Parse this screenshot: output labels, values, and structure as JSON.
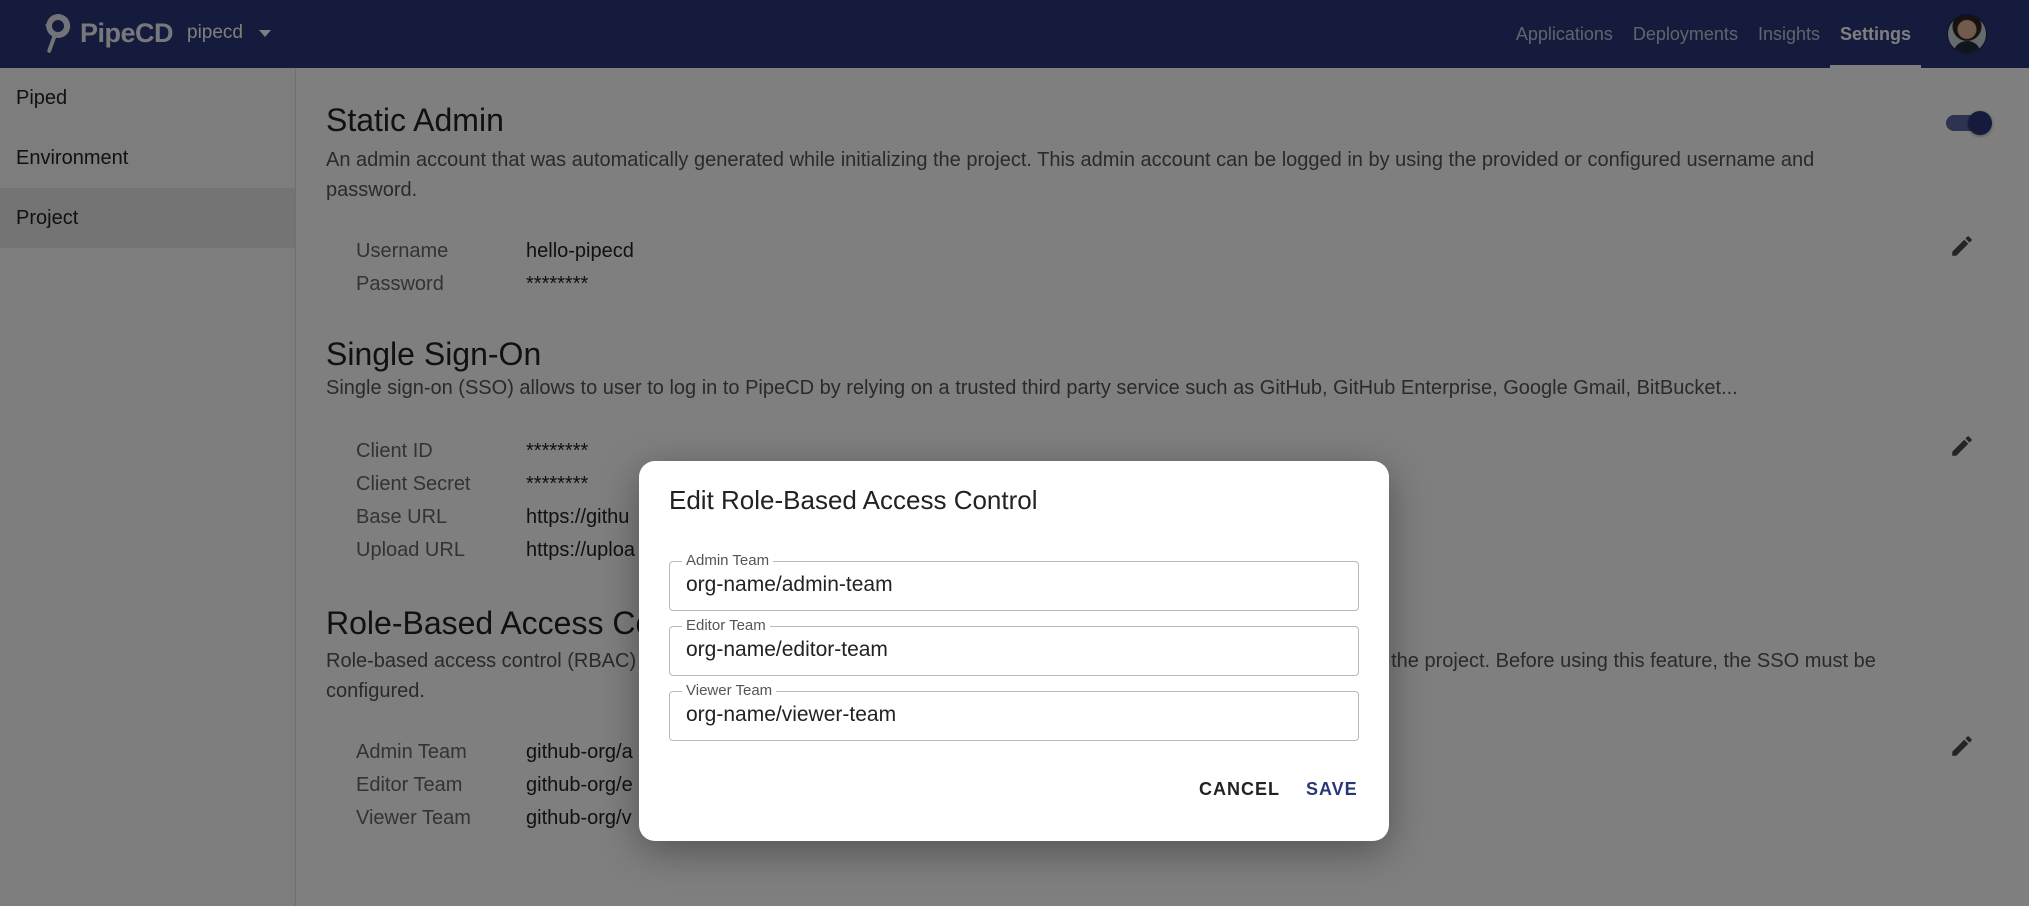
{
  "header": {
    "logo_text": "PipeCD",
    "project": "pipecd",
    "nav": [
      {
        "label": "Applications"
      },
      {
        "label": "Deployments"
      },
      {
        "label": "Insights"
      },
      {
        "label": "Settings",
        "active": true
      }
    ],
    "colors": {
      "bar": "#283778"
    }
  },
  "sidebar": {
    "items": [
      {
        "label": "Piped"
      },
      {
        "label": "Environment"
      },
      {
        "label": "Project",
        "active": true
      }
    ]
  },
  "static_admin": {
    "title": "Static Admin",
    "description": "An admin account that was automatically generated while initializing the project. This admin account can be logged in by using the provided or configured username and password.",
    "enabled": true,
    "fields": [
      {
        "key": "Username",
        "value": "hello-pipecd"
      },
      {
        "key": "Password",
        "value": "********"
      }
    ]
  },
  "sso": {
    "title": "Single Sign-On",
    "description": "Single sign-on (SSO) allows to user to log in to PipeCD by relying on a trusted third party service such as GitHub, GitHub Enterprise, Google Gmail, BitBucket...",
    "fields": [
      {
        "key": "Client ID",
        "value": "********"
      },
      {
        "key": "Client Secret",
        "value": "********"
      },
      {
        "key": "Base URL",
        "value": "https://githu"
      },
      {
        "key": "Upload URL",
        "value": "https://uploa"
      }
    ]
  },
  "rbac": {
    "title": "Role-Based Access Con",
    "description_left": "Role-based access control (RBAC)",
    "description_right": "in the project. Before using this feature, the SSO must be",
    "description_line2": "configured.",
    "fields": [
      {
        "key": "Admin Team",
        "value": "github-org/a"
      },
      {
        "key": "Editor Team",
        "value": "github-org/e"
      },
      {
        "key": "Viewer Team",
        "value": "github-org/v"
      }
    ]
  },
  "dialog": {
    "title": "Edit Role-Based Access Control",
    "fields": [
      {
        "label": "Admin Team",
        "value": "org-name/admin-team"
      },
      {
        "label": "Editor Team",
        "value": "org-name/editor-team"
      },
      {
        "label": "Viewer Team",
        "value": "org-name/viewer-team"
      }
    ],
    "cancel_label": "CANCEL",
    "save_label": "SAVE",
    "colors": {
      "save": "#283778",
      "cancel": "#222222"
    }
  }
}
